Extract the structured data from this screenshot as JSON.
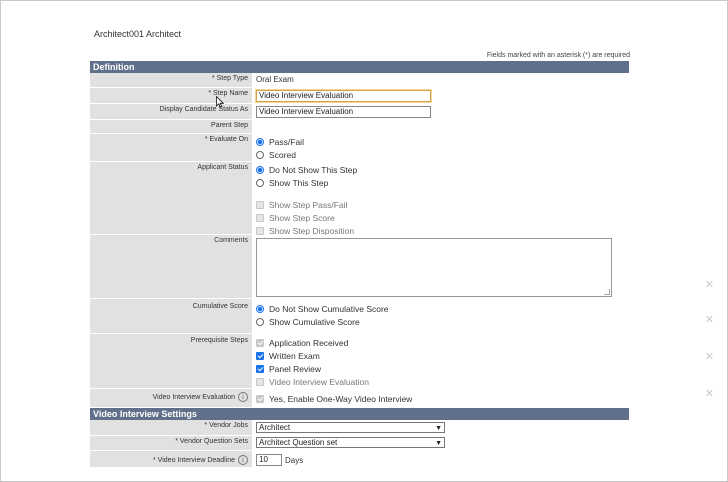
{
  "header": {
    "title": "Architect001 Architect",
    "required_note": "Fields marked with an asterisk (*) are required"
  },
  "definition": {
    "section_title": "Definition",
    "step_type": {
      "label": "* Step Type",
      "value": "Oral Exam"
    },
    "step_name": {
      "label": "* Step Name",
      "value": "Video Interview Evaluation"
    },
    "display_status": {
      "label": "Display Candidate Status As",
      "value": "Video Interview Evaluation"
    },
    "parent_step": {
      "label": "Parent Step"
    },
    "evaluate_on": {
      "label": "* Evaluate On",
      "options": [
        "Pass/Fail",
        "Scored"
      ],
      "selected": "Pass/Fail"
    },
    "applicant_status": {
      "label": "Applicant Status",
      "options": [
        "Do Not Show This Step",
        "Show This Step"
      ],
      "selected": "Do Not Show This Step",
      "checks": [
        "Show Step Pass/Fail",
        "Show Step Score",
        "Show Step Disposition"
      ]
    },
    "comments": {
      "label": "Comments"
    },
    "cumulative_score": {
      "label": "Cumulative Score",
      "options": [
        "Do Not Show Cumulative Score",
        "Show Cumulative Score"
      ],
      "selected": "Do Not Show Cumulative Score"
    },
    "prerequisite_steps": {
      "label": "Prerequisite Steps",
      "items": [
        {
          "text": "Application Received",
          "checked": true,
          "disabled": true
        },
        {
          "text": "Written Exam",
          "checked": true,
          "disabled": false
        },
        {
          "text": "Panel Review",
          "checked": true,
          "disabled": false
        },
        {
          "text": "Video Interview Evaluation",
          "checked": false,
          "disabled": true
        }
      ]
    },
    "video_eval": {
      "label": "Video Interview Evaluation",
      "check_text": "Yes, Enable One-Way Video Interview",
      "info_icon": "info-icon"
    }
  },
  "video_settings": {
    "section_title": "Video Interview Settings",
    "vendor_jobs": {
      "label": "* Vendor Jobs",
      "value": "Architect"
    },
    "vendor_question_sets": {
      "label": "* Vendor Question Sets",
      "value": "Architect Question set"
    },
    "deadline": {
      "label": "* Video Interview Deadline",
      "value": "10",
      "unit": "Days"
    }
  },
  "close_icons": [
    "close-icon",
    "close-icon",
    "close-icon",
    "close-icon"
  ],
  "colors": {
    "section_bar": "#61708a",
    "label_bg": "#e1e1e1",
    "accent": "#1a73e8"
  }
}
